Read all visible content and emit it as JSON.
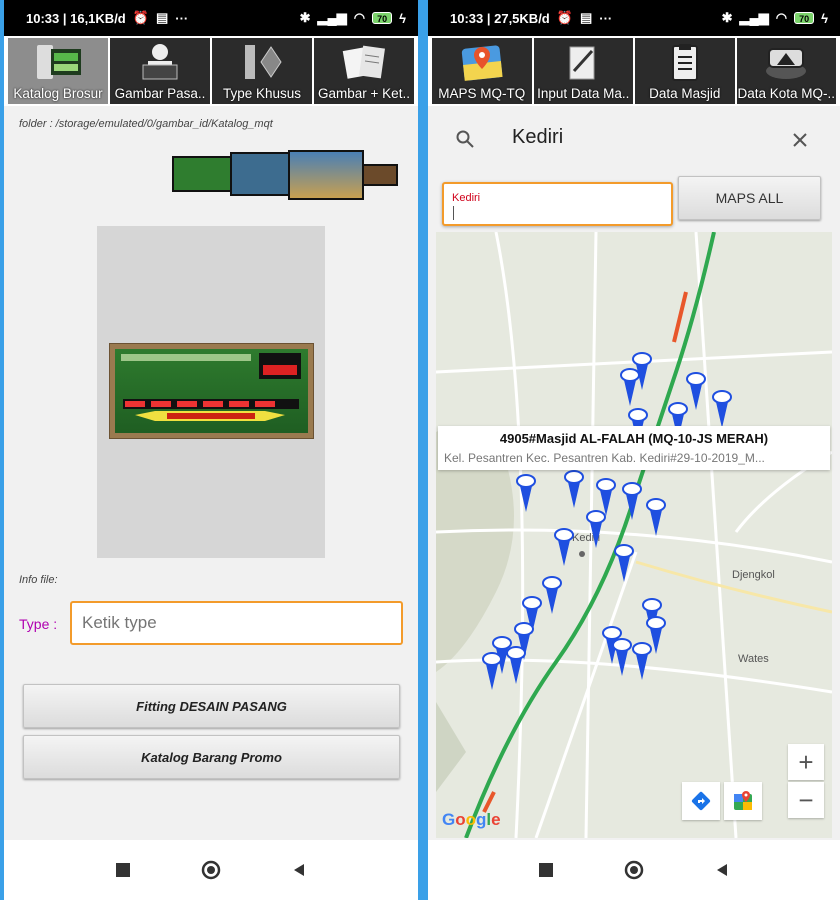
{
  "left_phone": {
    "status": {
      "time_network": "10:33 | 16,1KB/d",
      "more": "···",
      "battery": "70"
    },
    "tabs": [
      {
        "label": "Katalog Brosur",
        "icon": "brochure-catalog-icon"
      },
      {
        "label": "Gambar Pasa..",
        "icon": "person-display-icon"
      },
      {
        "label": "Type Khusus",
        "icon": "special-type-icon"
      },
      {
        "label": "Gambar + Ket..",
        "icon": "papers-icon"
      }
    ],
    "folder_path": "folder : /storage/emulated/0/gambar_id/Katalog_mqt",
    "info_file_label": "Info file:",
    "type_label": "Type :",
    "type_placeholder": "Ketik type",
    "buttons": {
      "fitting": "Fitting DESAIN PASANG",
      "promo": "Katalog Barang Promo"
    }
  },
  "right_phone": {
    "status": {
      "time_network": "10:33 | 27,5KB/d",
      "more": "···",
      "battery": "70"
    },
    "tabs": [
      {
        "label": "MAPS MQ-TQ",
        "icon": "maps-pin-icon"
      },
      {
        "label": "Input Data Ma..",
        "icon": "input-data-icon"
      },
      {
        "label": "Data Masjid",
        "icon": "clipboard-icon"
      },
      {
        "label": "Data Kota MQ-..",
        "icon": "city-data-icon"
      }
    ],
    "search": {
      "query": "Kediri"
    },
    "input": {
      "label": "Kediri"
    },
    "maps_all_label": "MAPS ALL",
    "callout": {
      "title": "4905#Masjid AL-FALAH (MQ-10-JS MERAH)",
      "subtitle": "Kel. Pesantren Kec. Pesantren Kab. Kediri#29-10-2019_M..."
    },
    "places": {
      "kediri": "Kediri",
      "djengkol": "Djengkol",
      "wates": "Wates"
    },
    "zoom_in": "+",
    "zoom_out": "−",
    "google": "Google"
  },
  "colors": {
    "accent_orange": "#f39b2b",
    "type_label": "#b000b0",
    "pin_blue": "#1f4fe0",
    "background_blue": "#3aa0e8"
  }
}
